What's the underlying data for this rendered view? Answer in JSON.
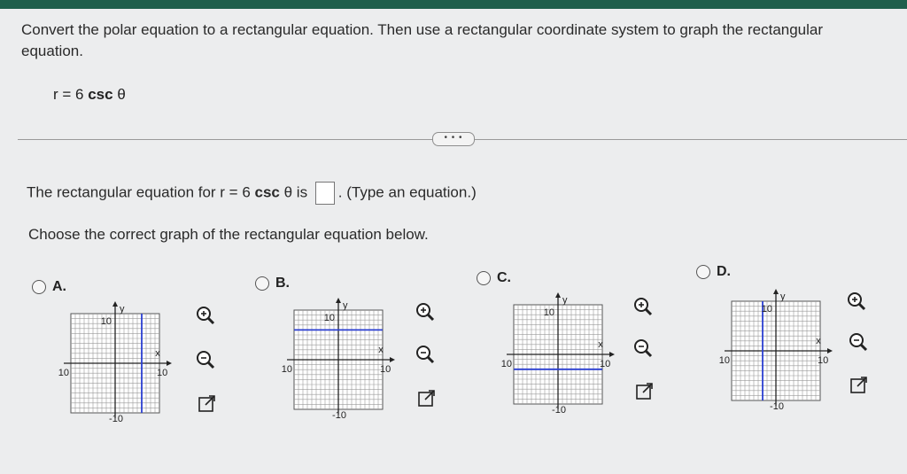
{
  "instructions": "Convert the polar equation to a rectangular equation. Then use a rectangular coordinate system to graph the rectangular equation.",
  "equation": {
    "prefix": "r = 6 ",
    "func": "csc",
    "suffix": " θ"
  },
  "more_button": "• • •",
  "question": {
    "part1": "The rectangular equation for r = 6 ",
    "func": "csc",
    "part2": " θ is ",
    "part3": ". (Type an equation.)",
    "answer_value": ""
  },
  "choose_prompt": "Choose the correct graph of the rectangular equation below.",
  "options": [
    {
      "label": "A.",
      "line": "vertical",
      "line_value": 6,
      "axis_max": 10,
      "tick_top": "10",
      "tick_bottom": "-10",
      "tick_left": "-10",
      "tick_right": "10",
      "x_label": "x",
      "y_label": "y"
    },
    {
      "label": "B.",
      "line": "horizontal",
      "line_value": 6,
      "axis_max": 10,
      "tick_top": "10",
      "tick_bottom": "-10",
      "tick_left": "-10",
      "tick_right": "10",
      "x_label": "x",
      "y_label": "y"
    },
    {
      "label": "C.",
      "line": "horizontal",
      "line_value": -3,
      "axis_max": 10,
      "tick_top": "10",
      "tick_bottom": "-10",
      "tick_left": "-10",
      "tick_right": "10",
      "x_label": "x",
      "y_label": "y"
    },
    {
      "label": "D.",
      "line": "vertical",
      "line_value": -3,
      "axis_max": 10,
      "tick_top": "10",
      "tick_bottom": "-10",
      "tick_left": "-10",
      "tick_right": "10",
      "x_label": "x",
      "y_label": "y"
    }
  ],
  "colors": {
    "line": "#2b3fd1",
    "grid": "#9a9a9a",
    "axis": "#222222",
    "header": "#1f5f4c"
  },
  "icons": [
    "zoom-in-icon",
    "zoom-out-icon",
    "popout-icon"
  ]
}
